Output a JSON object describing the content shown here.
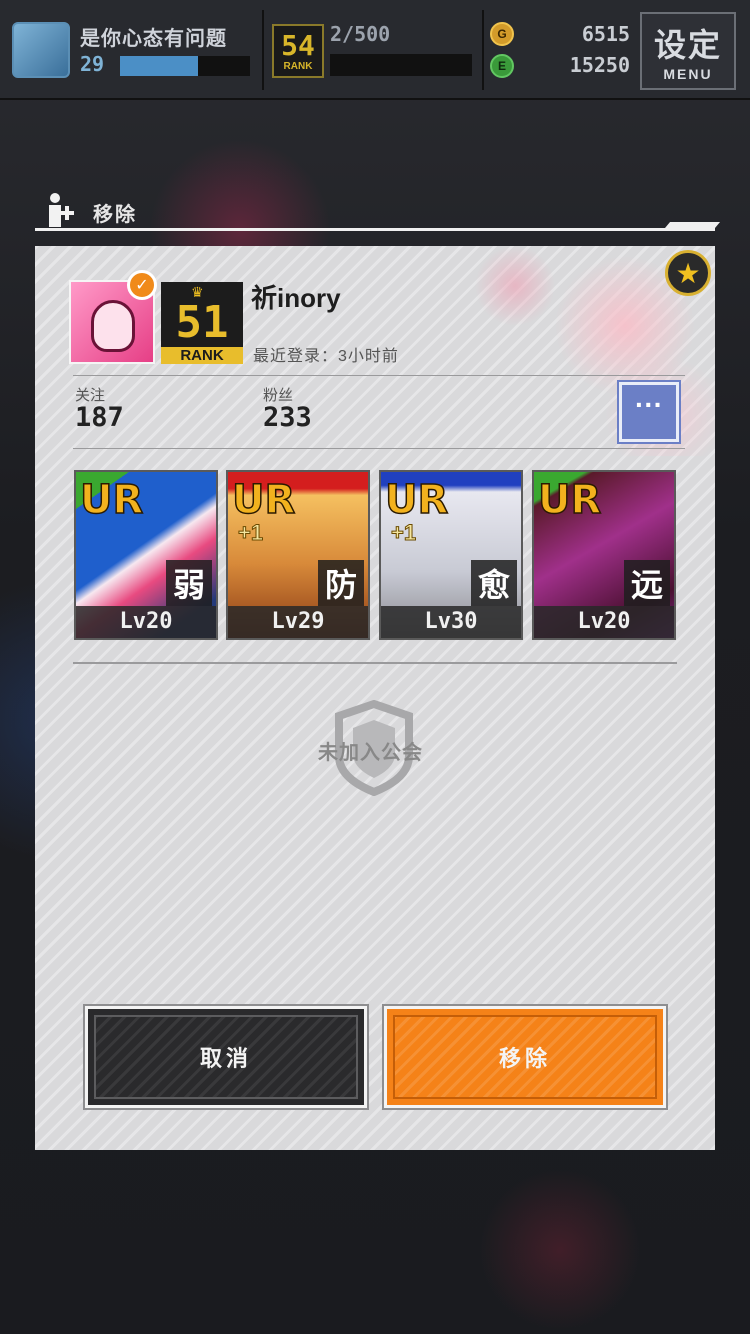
{
  "hud": {
    "player_name": "是你心态有问题",
    "player_level": "29",
    "xp_fraction": 0.6,
    "rank_number": "54",
    "rank_label": "RANK",
    "stamina": "2/500",
    "gold_icon": "G",
    "gold_amount": "6515",
    "energy_icon": "E",
    "energy_amount": "15250",
    "menu_label": "设定",
    "menu_sub": "MENU"
  },
  "dialog": {
    "title": "移除",
    "title_icon": "add-person-icon"
  },
  "profile": {
    "name": "祈inory",
    "rank_number": "51",
    "rank_label": "RANK",
    "last_login": "最近登录：3小时前",
    "verified_icon": "checkmark-icon",
    "favorite_icon": "star-icon",
    "follow_label": "关注",
    "follow_count": "187",
    "fans_label": "粉丝",
    "fans_count": "233",
    "more_label": "···"
  },
  "cards": [
    {
      "rarity": "UR",
      "plus": "",
      "role": "弱",
      "level": "Lv20"
    },
    {
      "rarity": "UR",
      "plus": "+1",
      "role": "防",
      "level": "Lv29"
    },
    {
      "rarity": "UR",
      "plus": "+1",
      "role": "愈",
      "level": "Lv30"
    },
    {
      "rarity": "UR",
      "plus": "",
      "role": "远",
      "level": "Lv20"
    }
  ],
  "guild": {
    "status": "未加入公会",
    "icon": "shield-icon"
  },
  "buttons": {
    "cancel": "取消",
    "remove": "移除"
  },
  "colors": {
    "accent_orange": "#f58218",
    "more_button": "#6b7fc6",
    "rank_gold": "#e8bd2c"
  }
}
